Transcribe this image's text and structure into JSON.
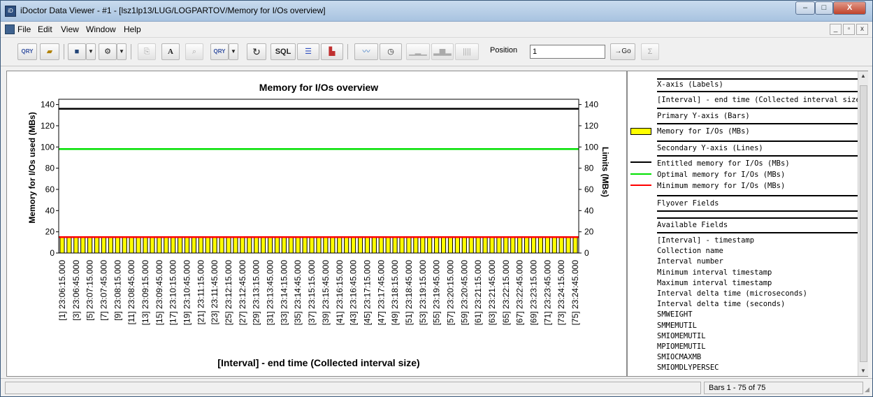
{
  "window": {
    "title": "iDoctor Data Viewer - #1 - [lsz1lp13/LUG/LOGPARTOV/Memory for I/Os overview]",
    "min_label": "–",
    "max_label": "□",
    "close_label": "X"
  },
  "menubar": {
    "items": [
      "File",
      "Edit",
      "View",
      "Window",
      "Help"
    ],
    "mdi_controls": [
      "_",
      "▫",
      "x"
    ]
  },
  "toolbar": {
    "qry_label": "QRY",
    "font_label": "A",
    "sql_label": "SQL",
    "position_label": "Position",
    "position_value": "1",
    "go_label": "→Go",
    "sum_label": "Σ"
  },
  "legend": {
    "header_x": "X-axis (Labels)",
    "x_field": "[Interval] - end time (Collected interval size)",
    "header_primary": "Primary Y-axis (Bars)",
    "primary_fields": [
      {
        "label": "Memory for I/Os (MBs)",
        "color": "#ffff00"
      }
    ],
    "header_secondary": "Secondary Y-axis (Lines)",
    "secondary_fields": [
      {
        "label": "Entitled memory for I/Os (MBs)",
        "color": "#000000"
      },
      {
        "label": "Optimal memory for I/Os (MBs)",
        "color": "#00e000"
      },
      {
        "label": "Minimum memory for I/Os (MBs)",
        "color": "#ff0000"
      }
    ],
    "header_flyover": "Flyover Fields",
    "header_available": "Available Fields",
    "available_fields": [
      "[Interval] - timestamp",
      "Collection name",
      "Interval number",
      "Minimum interval timestamp",
      "Maximum interval timestamp",
      "Interval delta time (microseconds)",
      "Interval delta time (seconds)",
      "SMWEIGHT",
      "SMMEMUTIL",
      "SMIOMEMUTIL",
      "MPIOMEMUTIL",
      "SMIOCMAXMB",
      "SMIOMDLYPERSEC"
    ]
  },
  "status": {
    "right": "Bars 1 - 75 of 75"
  },
  "chart_data": {
    "type": "bar",
    "title": "Memory for I/Os overview",
    "xlabel": "[Interval] - end time (Collected interval size)",
    "ylabel": "Memory for I/Os used (MBs)",
    "y2label": "Limits (MBs)",
    "ylim": [
      0,
      145
    ],
    "yticks": [
      0,
      20,
      40,
      60,
      80,
      100,
      120,
      140
    ],
    "bar_count": 75,
    "bar_value": 15,
    "bar_color": "#ffff00",
    "x_tick_labels": [
      "[1] 23:06:15.000",
      "[3] 23:06:45.000",
      "[5] 23:07:15.000",
      "[7] 23:07:45.000",
      "[9] 23:08:15.000",
      "[11] 23:08:45.000",
      "[13] 23:09:15.000",
      "[15] 23:09:45.000",
      "[17] 23:10:15.000",
      "[19] 23:10:45.000",
      "[21] 23:11:15.000",
      "[23] 23:11:45.000",
      "[25] 23:12:15.000",
      "[27] 23:12:45.000",
      "[29] 23:13:15.000",
      "[31] 23:13:45.000",
      "[33] 23:14:15.000",
      "[35] 23:14:45.000",
      "[37] 23:15:15.000",
      "[39] 23:15:45.000",
      "[41] 23:16:15.000",
      "[43] 23:16:45.000",
      "[45] 23:17:15.000",
      "[47] 23:17:45.000",
      "[49] 23:18:15.000",
      "[51] 23:18:45.000",
      "[53] 23:19:15.000",
      "[55] 23:19:45.000",
      "[57] 23:20:15.000",
      "[59] 23:20:45.000",
      "[61] 23:21:15.000",
      "[63] 23:21:45.000",
      "[65] 23:22:15.000",
      "[67] 23:22:45.000",
      "[69] 23:23:15.000",
      "[71] 23:23:45.000",
      "[73] 23:24:15.000",
      "[75] 23:24:45.000"
    ],
    "lines": [
      {
        "name": "Entitled memory for I/Os (MBs)",
        "value": 136,
        "color": "#000000"
      },
      {
        "name": "Optimal memory for I/Os (MBs)",
        "value": 98,
        "color": "#00e000"
      },
      {
        "name": "Minimum memory for I/Os (MBs)",
        "value": 15,
        "color": "#ff0000"
      }
    ],
    "grid": false
  }
}
